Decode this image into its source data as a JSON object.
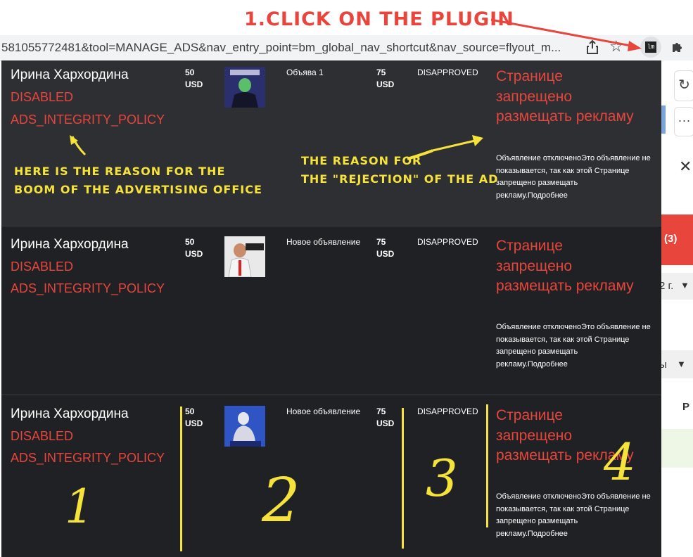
{
  "annotations": {
    "click_plugin": "1.CLICK ON THE PLUGIN",
    "reason_office_line1": "HERE IS THE REASON FOR THE",
    "reason_office_line2": "BOOM OF THE ADVERTISING OFFICE",
    "reason_ad_line1": "THE REASON FOR",
    "reason_ad_line2": "THE \"REJECTION\" OF THE AD",
    "col_numbers": [
      "1",
      "2",
      "3",
      "4"
    ]
  },
  "browser": {
    "url": "581055772481&tool=MANAGE_ADS&nav_entry_point=bm_global_nav_shortcut&nav_source=flyout_m...",
    "plugin_icon_label": "lm",
    "icons": [
      "share-icon",
      "star-icon",
      "plugin-icon",
      "puzzle-icon"
    ]
  },
  "background_page": {
    "badge_count": "(3)",
    "date_fragment": "2 г.",
    "text_fragment": "ы",
    "column_letter": "Р"
  },
  "rows": [
    {
      "name": "Ирина Хархордина",
      "account_status": "DISABLED",
      "disable_reason": "ADS_INTEGRITY_POLICY",
      "budget_amount": "50",
      "budget_currency": "USD",
      "ad_name": "Объява 1",
      "spend_amount": "75",
      "spend_currency": "USD",
      "ad_status": "DISAPPROVED",
      "reason_title": "Странице запрещено размещать рекламу",
      "reason_desc": "Объявление отключеноЭто объявление не показывается, так как этой Странице запрещено размещать рекламу.Подробнее"
    },
    {
      "name": "Ирина Хархордина",
      "account_status": "DISABLED",
      "disable_reason": "ADS_INTEGRITY_POLICY",
      "budget_amount": "50",
      "budget_currency": "USD",
      "ad_name": "Новое объявление",
      "spend_amount": "75",
      "spend_currency": "USD",
      "ad_status": "DISAPPROVED",
      "reason_title": "Странице запрещено размещать рекламу",
      "reason_desc": "Объявление отключеноЭто объявление не показывается, так как этой Странице запрещено размещать рекламу.Подробнее"
    },
    {
      "name": "Ирина Хархордина",
      "account_status": "DISABLED",
      "disable_reason": "ADS_INTEGRITY_POLICY",
      "budget_amount": "50",
      "budget_currency": "USD",
      "ad_name": "Новое объявление",
      "spend_amount": "75",
      "spend_currency": "USD",
      "ad_status": "DISAPPROVED",
      "reason_title": "Странице запрещено размещать рекламу",
      "reason_desc": "Объявление отключеноЭто объявление не показывается, так как этой Странице запрещено размещать рекламу.Подробнее"
    }
  ],
  "colors": {
    "annotation_yellow": "#f5e23a",
    "annotation_red": "#e8453c",
    "panel_bg": "#202124",
    "error_red": "#e8453c"
  }
}
